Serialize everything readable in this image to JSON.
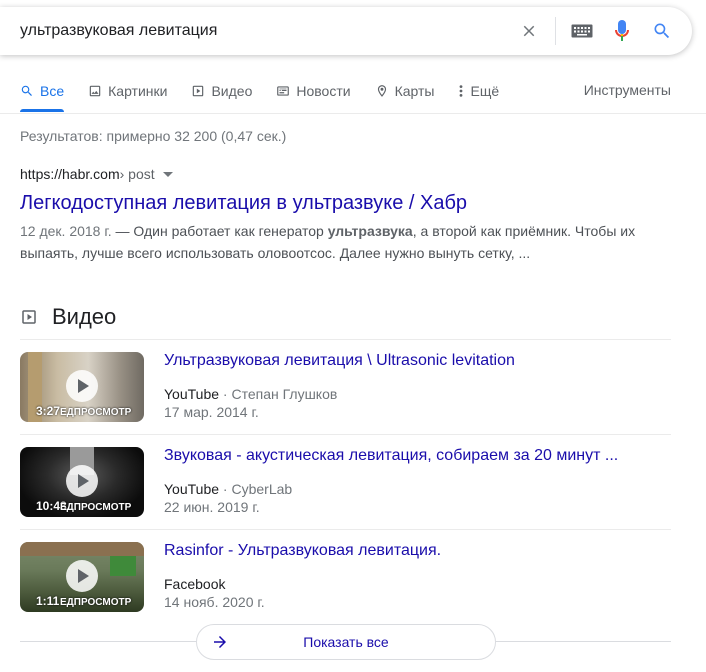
{
  "search": {
    "query": "ультразвуковая левитация"
  },
  "tabs": [
    {
      "label": "Все",
      "icon": "search-icon",
      "active": true
    },
    {
      "label": "Картинки",
      "icon": "image-icon"
    },
    {
      "label": "Видео",
      "icon": "video-icon"
    },
    {
      "label": "Новости",
      "icon": "news-icon"
    },
    {
      "label": "Карты",
      "icon": "map-pin-icon"
    },
    {
      "label": "Ещё",
      "icon": "more-vert-icon"
    }
  ],
  "tools_label": "Инструменты",
  "stats": "Результатов: примерно 32 200 (0,47 сек.)",
  "result": {
    "domain": "https://habr.com",
    "path": " › post",
    "title": "Легкодоступная левитация в ультразвуке / Хабр",
    "date": "12 дек. 2018 г.",
    "snippet_pre": " — Один работает как генератор ",
    "snippet_bold": "ультразвука",
    "snippet_post": ", а второй как приёмник. Чтобы их выпаять, лучше всего использовать оловоотсос. Далее нужно вынуть сетку, ..."
  },
  "videos": {
    "heading": "Видео",
    "items": [
      {
        "title": "Ультразвуковая левитация \\ Ultrasonic levitation",
        "source": "YouTube",
        "author": "Степан Глушков",
        "date": "17 мар. 2014 г.",
        "duration": "3:27",
        "preview_label": "ЕДПРОСМОТР"
      },
      {
        "title": "Звуковая - акустическая левитация, собираем за 20 минут ...",
        "source": "YouTube",
        "author": "CyberLab",
        "date": "22 июн. 2019 г.",
        "duration": "10:43",
        "preview_label": "ЕДПРОСМОТР"
      },
      {
        "title": "Rasinfor - Ультразвуковая левитация.",
        "source": "Facebook",
        "author": "",
        "date": "14 нояб. 2020 г.",
        "duration": "1:11",
        "preview_label": "ЕДПРОСМОТР"
      }
    ],
    "show_all_label": "Показать все"
  },
  "colors": {
    "link": "#1a0dab",
    "accent": "#1a73e8",
    "muted": "#70757a"
  }
}
